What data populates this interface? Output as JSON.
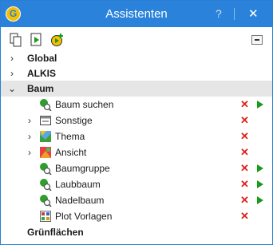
{
  "window": {
    "title": "Assistenten",
    "help": "?",
    "close": "✕",
    "app_letter": "G"
  },
  "tree": {
    "global": "Global",
    "alkis": "ALKIS",
    "baum": "Baum",
    "baum_suchen": "Baum suchen",
    "sonstige": "Sonstige",
    "thema": "Thema",
    "ansicht": "Ansicht",
    "baumgruppe": "Baumgruppe",
    "laubbaum": "Laubbaum",
    "nadelbaum": "Nadelbaum",
    "plot_vorlagen": "Plot Vorlagen",
    "gruenflaechen": "Grünflächen"
  },
  "glyphs": {
    "collapsed": "›",
    "expanded": "⌄",
    "remove": "✕"
  },
  "colors": {
    "titlebar": "#2a82da",
    "remove": "#e02020",
    "run": "#1a9a1a",
    "selected_row": "#e6e6e6"
  }
}
